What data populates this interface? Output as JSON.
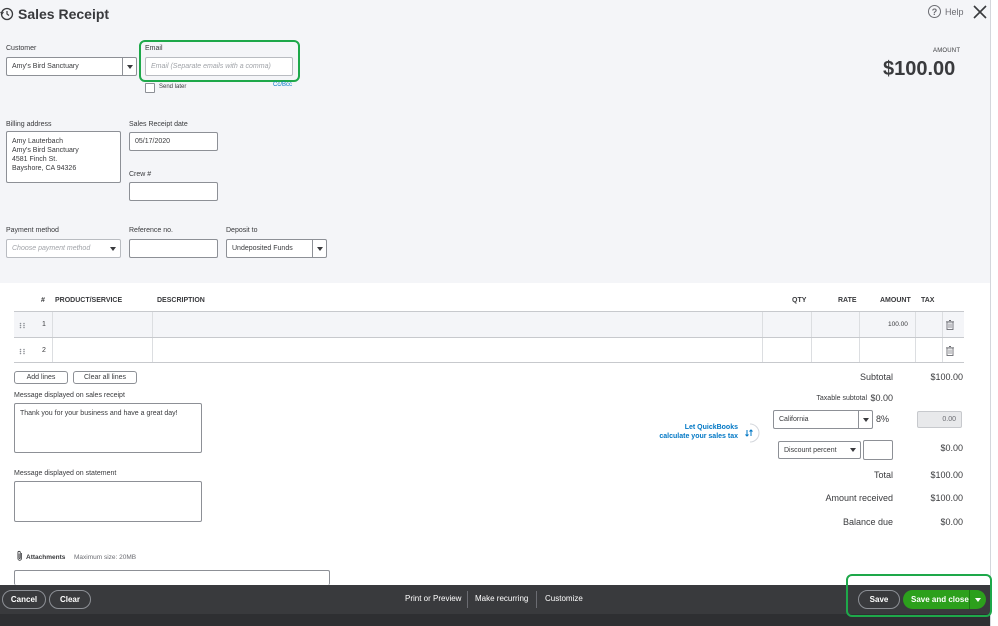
{
  "header": {
    "title": "Sales Receipt",
    "help_label": "Help",
    "amount_label": "AMOUNT",
    "amount_value": "$100.00"
  },
  "customer": {
    "label": "Customer",
    "value": "Amy's Bird Sanctuary"
  },
  "email": {
    "label": "Email",
    "placeholder": "Email (Separate emails with a comma)",
    "send_later_label": "Send later",
    "cc_bcc_label": "Cc/Bcc"
  },
  "billing": {
    "label": "Billing address",
    "value": "Amy Lauterbach\nAmy's Bird Sanctuary\n4581 Finch St.\nBayshore, CA  94326"
  },
  "receipt_date": {
    "label": "Sales Receipt date",
    "value": "05/17/2020"
  },
  "crew": {
    "label": "Crew #",
    "value": ""
  },
  "payment_method": {
    "label": "Payment method",
    "placeholder": "Choose payment method"
  },
  "reference": {
    "label": "Reference no.",
    "value": ""
  },
  "deposit_to": {
    "label": "Deposit to",
    "value": "Undeposited Funds"
  },
  "table": {
    "columns": {
      "num": "#",
      "product": "PRODUCT/SERVICE",
      "description": "DESCRIPTION",
      "qty": "QTY",
      "rate": "RATE",
      "amount": "AMOUNT",
      "tax": "TAX"
    },
    "rows": [
      {
        "num": "1",
        "amount": "100.00"
      },
      {
        "num": "2",
        "amount": ""
      }
    ],
    "add_lines_label": "Add lines",
    "clear_lines_label": "Clear all lines"
  },
  "messages": {
    "receipt_label": "Message displayed on sales receipt",
    "receipt_value": "Thank you for your business and have a great day!",
    "statement_label": "Message displayed on statement",
    "statement_value": ""
  },
  "attachments": {
    "label": "Attachments",
    "max_size": "Maximum size: 20MB"
  },
  "totals": {
    "subtotal_label": "Subtotal",
    "subtotal_value": "$100.00",
    "taxable_label": "Taxable subtotal",
    "taxable_value": "$0.00",
    "qb_link_line1": "Let QuickBooks",
    "qb_link_line2": "calculate your sales tax",
    "tax_region": "California",
    "tax_rate": "8%",
    "tax_amount": "0.00",
    "discount_type": "Discount percent",
    "discount_value": "",
    "discount_amount": "$0.00",
    "total_label": "Total",
    "total_value": "$100.00",
    "received_label": "Amount received",
    "received_value": "$100.00",
    "balance_label": "Balance due",
    "balance_value": "$0.00"
  },
  "footer": {
    "cancel": "Cancel",
    "clear": "Clear",
    "print_preview": "Print or Preview",
    "make_recurring": "Make recurring",
    "customize": "Customize",
    "save": "Save",
    "save_close": "Save and close"
  },
  "colors": {
    "accent_green": "#2ca01c",
    "highlight_green": "#1ea84a",
    "link_blue": "#0077c5",
    "footer_bg": "#393a3d"
  }
}
